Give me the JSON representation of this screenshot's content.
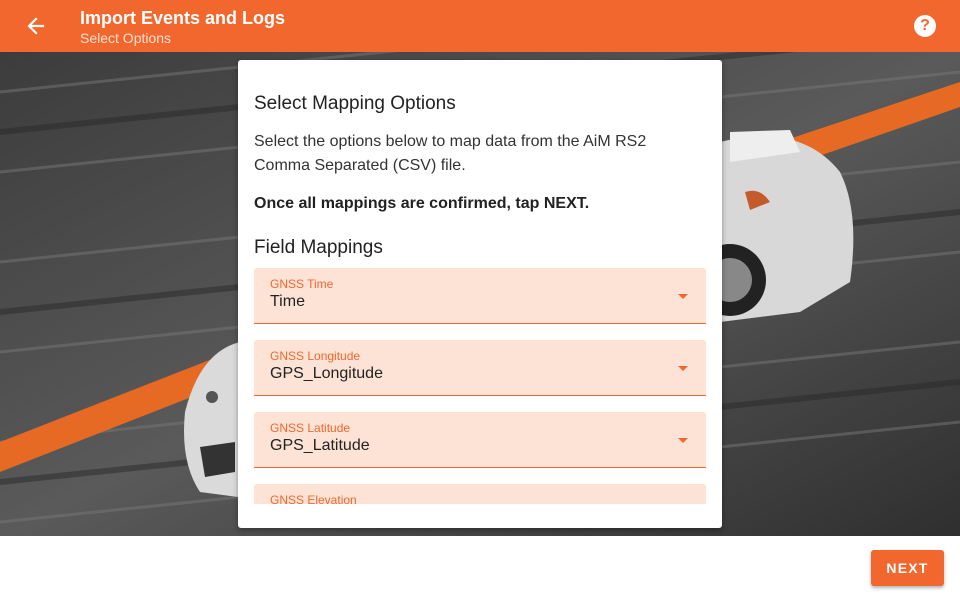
{
  "appbar": {
    "title": "Import Events and Logs",
    "subtitle": "Select Options",
    "back_icon": "arrow-left-icon",
    "help_icon": "help-circle-icon",
    "help_glyph": "?"
  },
  "colors": {
    "accent": "#f2672e",
    "field_bg": "#fde3d6"
  },
  "card": {
    "heading": "Select Mapping Options",
    "description": "Select the options below to map data from the AiM RS2 Comma Separated (CSV) file.",
    "instruction": "Once all mappings are confirmed, tap NEXT.",
    "field_mappings_heading": "Field Mappings",
    "fields": [
      {
        "label": "GNSS Time",
        "value": "Time"
      },
      {
        "label": "GNSS Longitude",
        "value": "GPS_Longitude"
      },
      {
        "label": "GNSS Latitude",
        "value": "GPS_Latitude"
      },
      {
        "label": "GNSS Elevation",
        "value": ""
      }
    ]
  },
  "footer": {
    "next_label": "NEXT"
  }
}
